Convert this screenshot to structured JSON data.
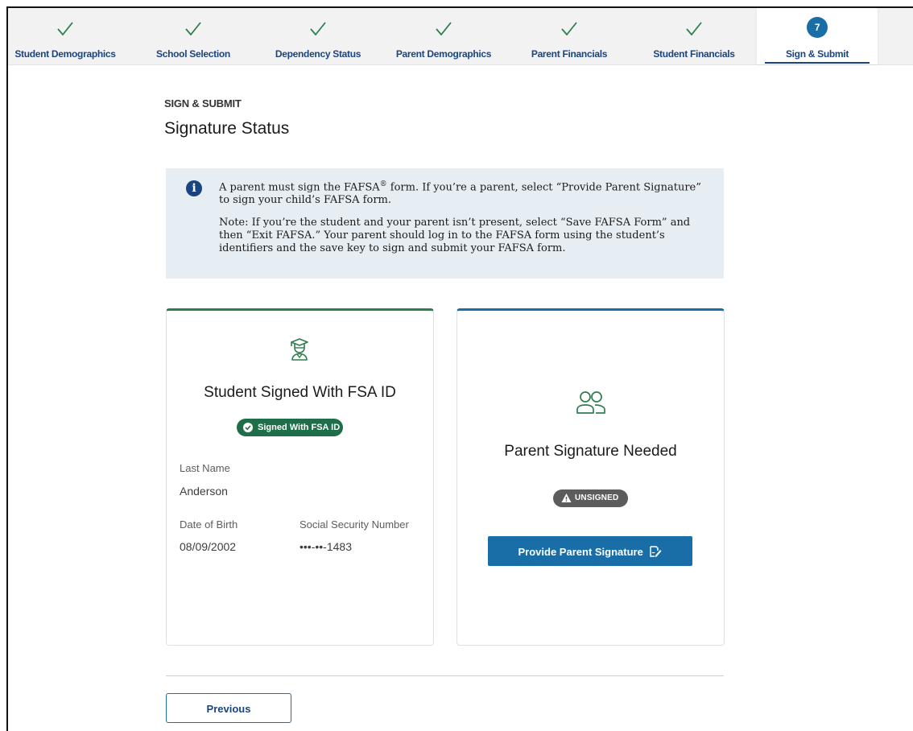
{
  "steps": [
    {
      "label": "Student Demographics",
      "state": "complete"
    },
    {
      "label": "School Selection",
      "state": "complete"
    },
    {
      "label": "Dependency Status",
      "state": "complete"
    },
    {
      "label": "Parent Demographics",
      "state": "complete"
    },
    {
      "label": "Parent Financials",
      "state": "complete"
    },
    {
      "label": "Student Financials",
      "state": "complete"
    },
    {
      "label": "Sign & Submit",
      "state": "active",
      "number": "7"
    }
  ],
  "header": {
    "eyebrow": "SIGN & SUBMIT",
    "title": "Signature Status"
  },
  "alert": {
    "p1_before": "A parent must sign the FAFSA",
    "p1_sup": "®",
    "p1_after": " form. If you’re a parent, select “Provide Parent Signature” to sign your child’s FAFSA form.",
    "p2": "Note: If you’re the student and your parent isn’t present, select “Save FAFSA Form” and then “Exit FAFSA.” Your parent should log in to the FAFSA form using the student’s identifiers and the save key to sign and submit your FAFSA form."
  },
  "student_card": {
    "title": "Student Signed With FSA ID",
    "badge": "Signed With FSA ID",
    "last_name_label": "Last Name",
    "last_name": "Anderson",
    "dob_label": "Date of Birth",
    "dob": "08/09/2002",
    "ssn_label": "Social Security Number",
    "ssn": "•••-••-1483"
  },
  "parent_card": {
    "title": "Parent Signature Needed",
    "badge": "UNSIGNED",
    "button": "Provide Parent Signature"
  },
  "footer": {
    "previous": "Previous"
  },
  "colors": {
    "primary": "#1a6ea8",
    "navy": "#1a4480",
    "success": "#1e6f49",
    "check": "#2e7d4f",
    "alert_bg": "#e6edf3",
    "neutral_badge": "#5c5c5c"
  }
}
